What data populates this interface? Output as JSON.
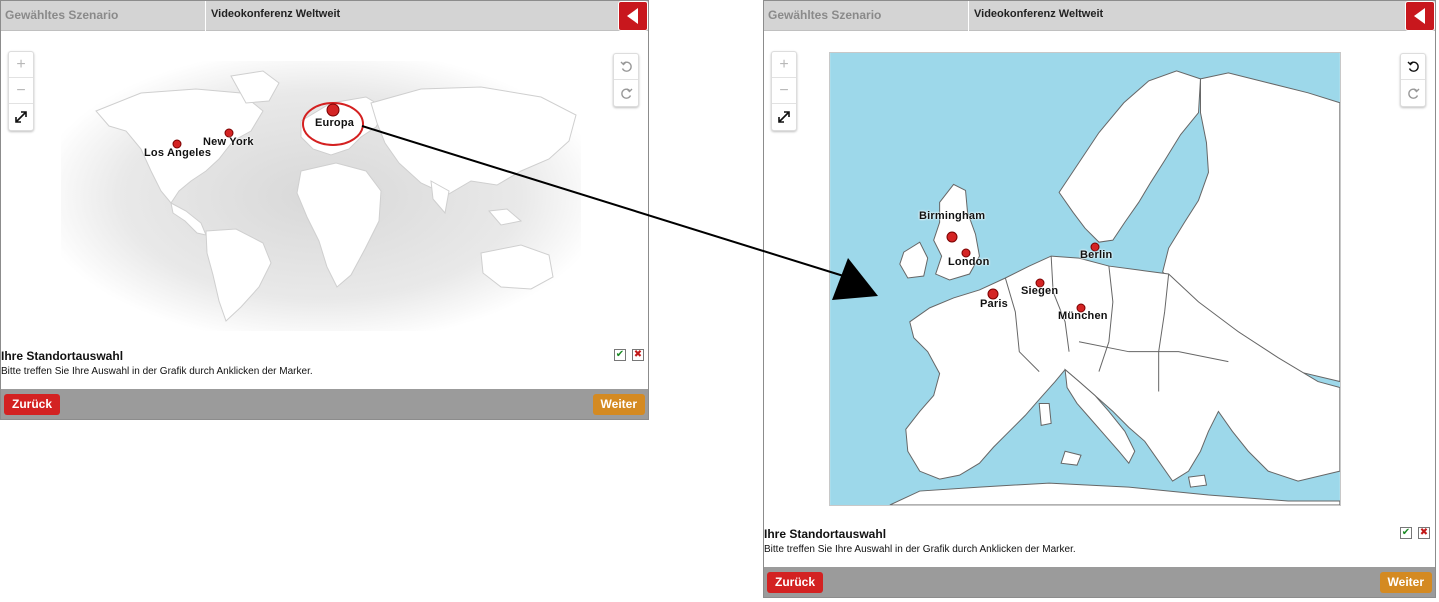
{
  "left_window": {
    "header": {
      "scenario_label": "Gewähltes Szenario",
      "scenario_title": "Videokonferenz Weltweit"
    },
    "zoom": {
      "in": "+",
      "out": "−"
    },
    "markers": [
      {
        "label": "Los Angeles"
      },
      {
        "label": "New York"
      },
      {
        "label": "Europa"
      }
    ],
    "info": {
      "title": "Ihre Standortauswahl",
      "text": "Bitte treffen Sie Ihre Auswahl in der Grafik durch Anklicken der Marker."
    },
    "footer": {
      "back_label": "Zurück",
      "next_label": "Weiter"
    }
  },
  "right_window": {
    "header": {
      "scenario_label": "Gewähltes Szenario",
      "scenario_title": "Videokonferenz Weltweit"
    },
    "zoom": {
      "in": "+",
      "out": "−"
    },
    "markers": [
      {
        "label": "Birmingham"
      },
      {
        "label": "London"
      },
      {
        "label": "Berlin"
      },
      {
        "label": "Siegen"
      },
      {
        "label": "Paris"
      },
      {
        "label": "München"
      }
    ],
    "info": {
      "title": "Ihre Standortauswahl",
      "text": "Bitte treffen Sie Ihre Auswahl in der Grafik durch Anklicken der Marker."
    },
    "footer": {
      "back_label": "Zurück",
      "next_label": "Weiter"
    }
  },
  "colors": {
    "header_bg": "#d4d4d4",
    "back_accent": "#c8171d",
    "button_back": "#d32222",
    "button_next": "#d48a22",
    "footer_bg": "#9b9b9b",
    "sea": "#9dd8ea",
    "marker": "#d42424"
  },
  "icons": [
    "caret-left-icon",
    "plus-icon",
    "minus-icon",
    "expand-icon",
    "undo-icon",
    "redo-icon",
    "check-icon",
    "cross-icon",
    "pin-icon",
    "arrow-annotation"
  ]
}
